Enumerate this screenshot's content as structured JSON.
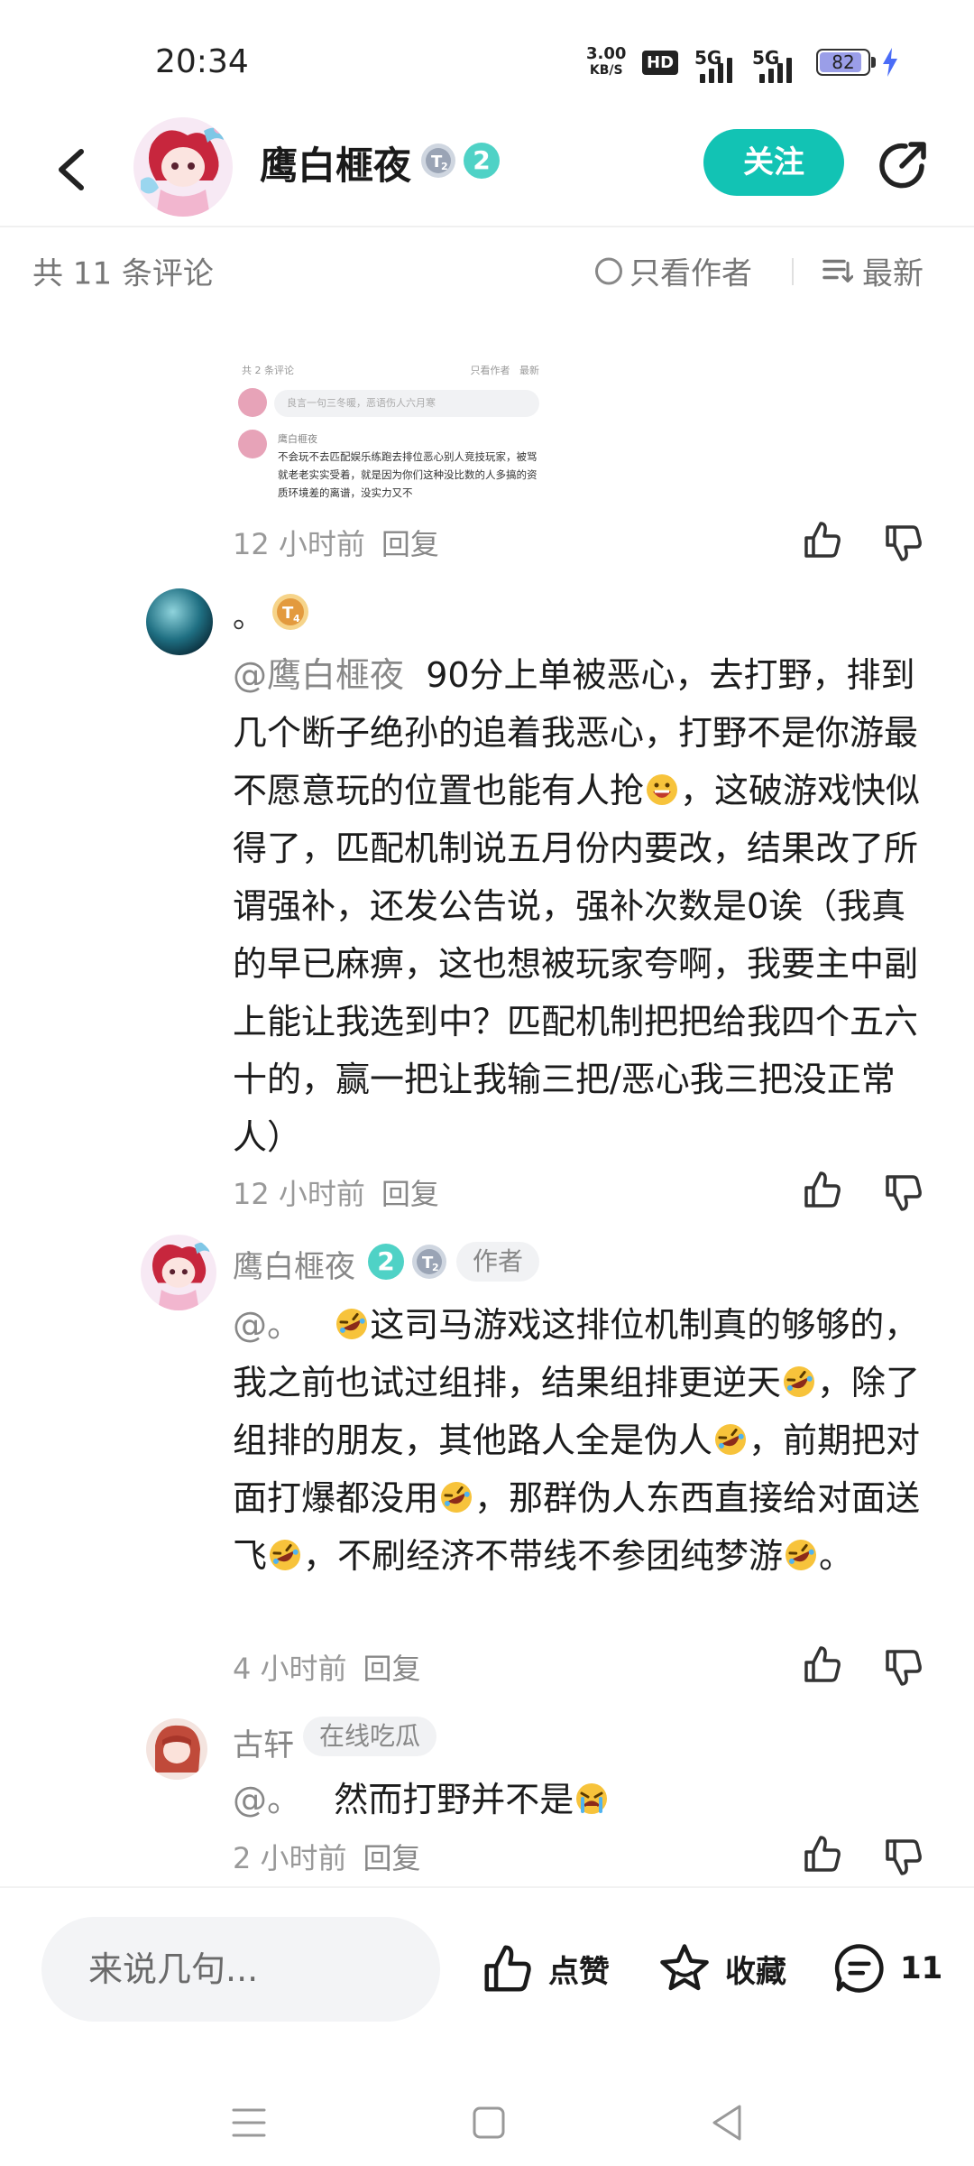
{
  "status_bar": {
    "time": "20:34",
    "net_speed_value": "3.00",
    "net_speed_unit": "KB/S",
    "hd": "HD",
    "sim1": "5G",
    "sim2": "5G",
    "battery": "82"
  },
  "header": {
    "username": "鹰白榧夜",
    "follow_label": "关注"
  },
  "comment_bar": {
    "count_label": "共 11 条评论",
    "only_author_label": "只看作者",
    "sort_label": "最新"
  },
  "embedded_screenshot": {
    "count_label": "共 2 条评论",
    "only_author_label": "只看作者",
    "sort_label": "最新",
    "input_placeholder": "良言一句三冬暖，恶语伤人六月寒",
    "name": "鹰白榧夜",
    "text": "不会玩不去匹配娱乐练跑去排位恶心别人竞技玩家，被骂就老老实实受着，就是因为你们这种没比数的人多搞的资质环境差的离谱，没实力又不"
  },
  "comments": [
    {
      "time": "12 小时前",
      "reply": "回复"
    },
    {
      "name": "。",
      "mention": "@鹰白榧夜",
      "text": "90分上单被恶心，去打野，排到几个断子绝孙的追着我恶心，打野不是你游最不愿意玩的位置也能有人抢",
      "text2": "，这破游戏快似得了，匹配机制说五月份内要改，结果改了所谓强补，还发公告说，强补次数是0诶（我真的早已麻痹，这也想被玩家夸啊，我要主中副上能让我选到中？匹配机制把把给我四个五六十的，赢一把让我输三把/恶心我三把没正常人）",
      "time": "12 小时前",
      "reply": "回复"
    },
    {
      "name": "鹰白榧夜",
      "tag": "作者",
      "mention": "@。",
      "seg1": "这司马游戏这排位机制真的够够的，我之前也试过组排，结果组排更逆天",
      "seg2": "，除了组排的朋友，其他路人全是伪人",
      "seg3": "，前期把对面打爆都没用",
      "seg4": "，那群伪人东西直接给对面送飞",
      "seg5": "，不刷经济不带线不参团纯梦游",
      "seg6": "。",
      "time": "4 小时前",
      "reply": "回复"
    },
    {
      "name": "古轩",
      "tag": "在线吃瓜",
      "mention": "@。",
      "text": "然而打野并不是",
      "time": "2 小时前",
      "reply": "回复"
    }
  ],
  "bottom_bar": {
    "input_placeholder": "来说几句...",
    "like_label": "点赞",
    "fav_label": "收藏",
    "comment_count": "11"
  },
  "colors": {
    "accent": "#12c3b4",
    "text_gray": "#888888"
  },
  "icons": [
    "back-icon",
    "share-icon",
    "thumb-up-icon",
    "thumb-down-icon",
    "star-icon",
    "comment-icon",
    "sort-icon",
    "menu-icon",
    "home-icon",
    "back-triangle-icon"
  ]
}
